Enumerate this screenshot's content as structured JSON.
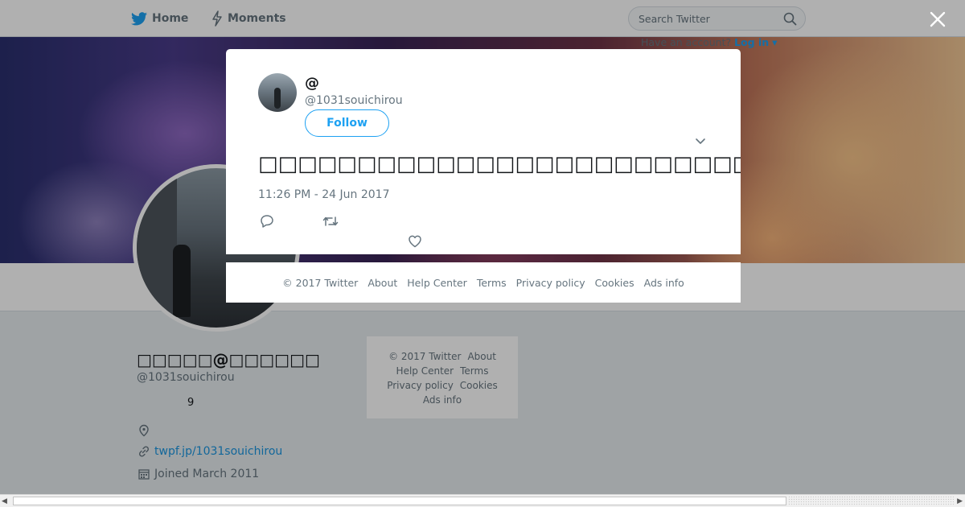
{
  "topbar": {
    "home_label": "Home",
    "moments_label": "Moments",
    "search_placeholder": "Search Twitter",
    "have_account_text": "Have an account?",
    "login_label": "Log in"
  },
  "profile": {
    "display_name": "□□□□□@□□□□□□",
    "handle": "@1031souichirou",
    "count": "9",
    "website": "twpf.jp/1031souichirou",
    "joined": "Joined March 2011"
  },
  "side_footer": {
    "copyright": "© 2017 Twitter",
    "about": "About",
    "help": "Help Center",
    "terms": "Terms",
    "privacy": "Privacy policy",
    "cookies": "Cookies",
    "ads": "Ads info"
  },
  "tweet": {
    "author_name": "@",
    "author_handle": "@1031souichirou",
    "follow_label": "Follow",
    "text": "□□□□□□□□□□□□□□□□□□□□□□□□□□□□□□□□□□□□□□□□□□□□□□□□□□□□□□□□□□□□□□□□□□",
    "timestamp": "11:26 PM - 24 Jun 2017"
  },
  "modal_footer": {
    "copyright": "© 2017 Twitter",
    "about": "About",
    "help": "Help Center",
    "terms": "Terms",
    "privacy": "Privacy policy",
    "cookies": "Cookies",
    "ads": "Ads info"
  },
  "colors": {
    "twitter_blue": "#1da1f2",
    "link_blue": "#1b95e0",
    "muted_text": "#66757f",
    "page_background": "#e6ecf0"
  }
}
